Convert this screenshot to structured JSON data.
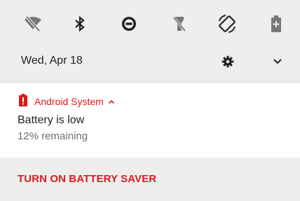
{
  "status": {
    "date": "Wed, Apr 18"
  },
  "quick_settings": [
    {
      "name": "wifi-off-icon",
      "label": "Wi-Fi off"
    },
    {
      "name": "bluetooth-icon",
      "label": "Bluetooth"
    },
    {
      "name": "do-not-disturb-icon",
      "label": "Do not disturb"
    },
    {
      "name": "flashlight-off-icon",
      "label": "Flashlight off"
    },
    {
      "name": "auto-rotate-icon",
      "label": "Auto-rotate"
    },
    {
      "name": "battery-saver-icon",
      "label": "Battery saver"
    }
  ],
  "notification": {
    "app_name": "Android System",
    "title": "Battery is low",
    "text": "12% remaining",
    "action_label": "TURN ON BATTERY SAVER"
  },
  "colors": {
    "accent": "#d81b1b",
    "shade_background": "#eeeeee",
    "icon_dark": "#222222",
    "icon_disabled": "#777777"
  }
}
